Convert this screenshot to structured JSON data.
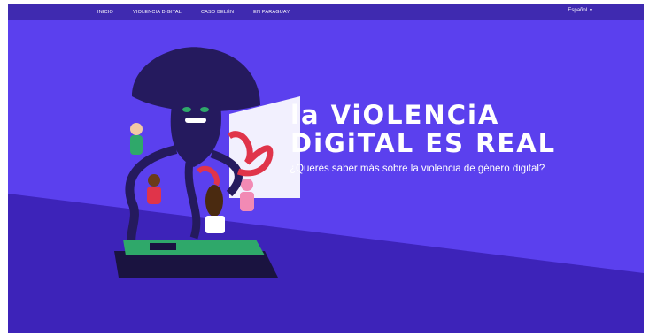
{
  "nav": {
    "items": [
      {
        "label": "INICIO"
      },
      {
        "label": "VIOLENCIA DIGITAL"
      },
      {
        "label": "CASO BELÉN"
      },
      {
        "label": "EN PARAGUAY"
      }
    ],
    "language": "Español",
    "language_icon": "chevron-down-icon"
  },
  "hero": {
    "title_line1": "la ViOLENCiA",
    "title_line2": "DiGiTAL ES REAL",
    "subtitle": "¿Querés saber más sobre la violencia de género digital?"
  },
  "colors": {
    "nav_bg": "#3f2ab0",
    "hero_bg": "#5b40ee",
    "lower_band": "#3d23b9",
    "accent_red": "#e0344a",
    "accent_green": "#2fa86a"
  }
}
